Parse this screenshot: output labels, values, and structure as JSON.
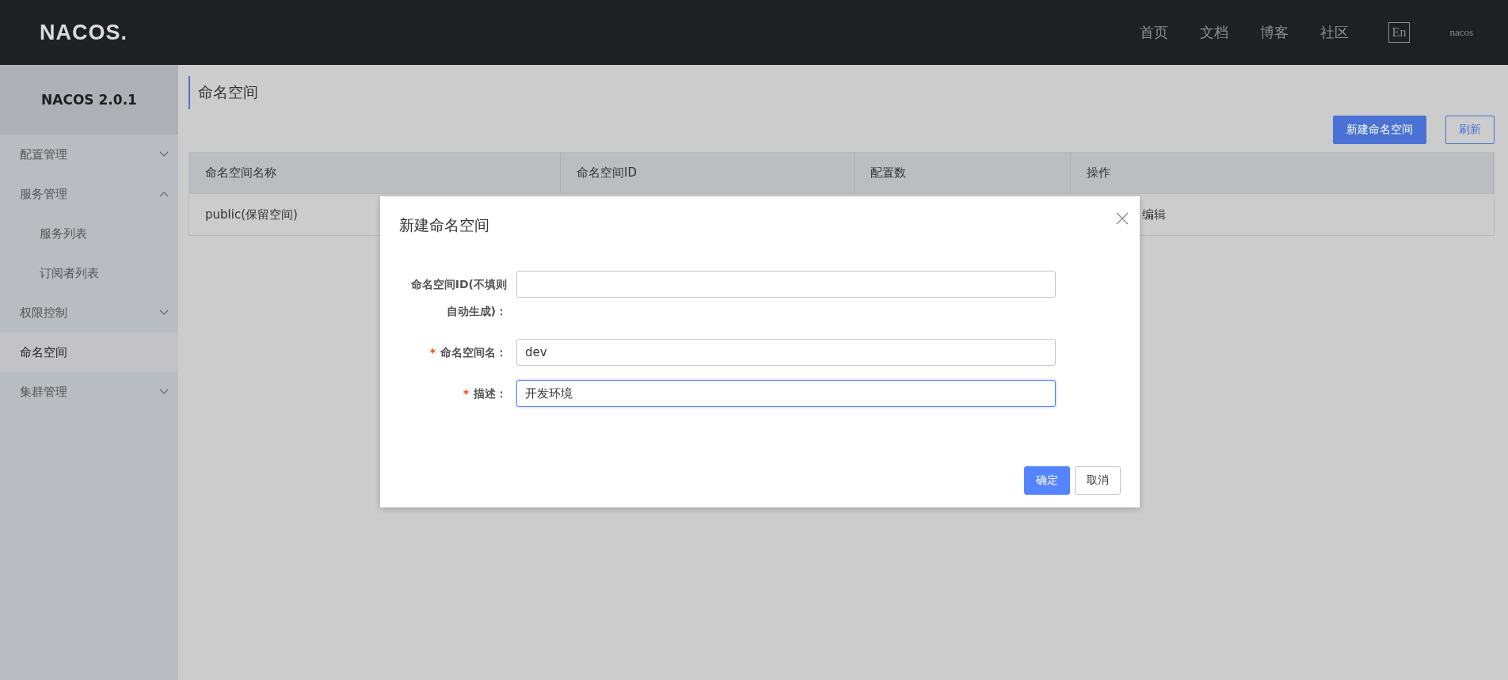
{
  "header": {
    "logo": "NACOS.",
    "nav": [
      {
        "label": "首页"
      },
      {
        "label": "文档"
      },
      {
        "label": "博客"
      },
      {
        "label": "社区"
      }
    ],
    "language": "En",
    "user": "nacos"
  },
  "sidebar": {
    "title": "NACOS 2.0.1",
    "items": [
      {
        "label": "配置管理",
        "selected": false,
        "expanded": false
      },
      {
        "label": "服务管理",
        "selected": false,
        "expanded": true,
        "children": [
          {
            "label": "服务列表",
            "selected": false
          },
          {
            "label": "订阅者列表",
            "selected": false
          }
        ]
      },
      {
        "label": "权限控制",
        "selected": false,
        "expanded": false
      },
      {
        "label": "命名空间",
        "selected": true
      },
      {
        "label": "集群管理",
        "selected": false,
        "expanded": false
      }
    ]
  },
  "page": {
    "title": "命名空间",
    "buttons": [
      {
        "label": "新建命名空间",
        "kind": "primary"
      },
      {
        "label": "刷新",
        "kind": "outline"
      }
    ]
  },
  "table": {
    "columns": [
      "命名空间名称",
      "命名空间ID",
      "配置数",
      "操作"
    ],
    "rows": [
      {
        "cells": [
          "public(保留空间)"
        ],
        "actions": [
          "编辑"
        ]
      }
    ]
  },
  "dialog": {
    "title": "新建命名空间",
    "required_marker": "*",
    "fields": [
      {
        "label": "命名空间ID(不填则自动生成)：",
        "required": false,
        "focused": false
      },
      {
        "label": "命名空间名：",
        "required": true,
        "value": "dev",
        "focused": false
      },
      {
        "label": "描述：",
        "required": true,
        "value": "开发环境",
        "focused": true
      }
    ],
    "buttons": [
      {
        "label": "确定",
        "kind": "primary"
      },
      {
        "label": "取消",
        "kind": "normal"
      }
    ]
  }
}
